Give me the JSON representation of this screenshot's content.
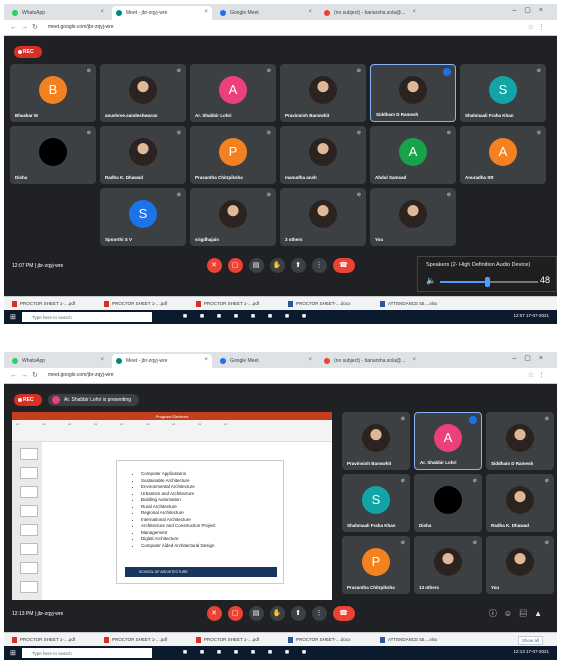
{
  "shot1": {
    "tabs": [
      {
        "label": "WhatsApp",
        "color": "#25d366",
        "active": false
      },
      {
        "label": "Meet - jbr-zqyj-wre",
        "color": "#00897b",
        "active": true
      },
      {
        "label": "Google Meet",
        "color": "#1a73e8",
        "active": false
      },
      {
        "label": "(no subject) - banarsha.sola@...",
        "color": "#ea4335",
        "active": false
      }
    ],
    "url": "meet.google.com/jbr-zqyj-wre",
    "rec_label": "REC",
    "tiles": [
      {
        "name": "Bhaskar M",
        "initial": "B",
        "color": "#f4811f",
        "kind": "letter"
      },
      {
        "name": "anushree.sandeshwaran",
        "initial": "",
        "color": "",
        "kind": "photo"
      },
      {
        "name": "Ar. Shabbir Lohri",
        "initial": "A",
        "color": "#ec407a",
        "kind": "letter"
      },
      {
        "name": "Pravinsinh Banswhit",
        "initial": "",
        "color": "",
        "kind": "photo"
      },
      {
        "name": "Siddham D Ramesh",
        "initial": "",
        "color": "",
        "kind": "photo"
      },
      {
        "name": "Shahmaali Fraha Khan",
        "initial": "S",
        "color": "#12a4a6",
        "kind": "letter"
      },
      {
        "name": "Disha",
        "initial": "",
        "color": "",
        "kind": "dark"
      },
      {
        "name": "Radha K. Dhawad",
        "initial": "",
        "color": "",
        "kind": "photo"
      },
      {
        "name": "Prasantha Chitrpiksha",
        "initial": "P",
        "color": "#f4811f",
        "kind": "letter"
      },
      {
        "name": "manudha ansh",
        "initial": "",
        "color": "",
        "kind": "photo"
      },
      {
        "name": "Abdul Samsad",
        "initial": "A",
        "color": "#16a34a",
        "kind": "letter"
      },
      {
        "name": "Anuradha SR",
        "initial": "A",
        "color": "#f4811f",
        "kind": "letter"
      },
      {
        "name": "Spoorthi S V",
        "initial": "S",
        "color": "#1a73e8",
        "kind": "letter"
      },
      {
        "name": "srigdhajain",
        "initial": "",
        "color": "",
        "kind": "photo"
      },
      {
        "name": "3 others",
        "initial": "",
        "color": "",
        "kind": "photo"
      },
      {
        "name": "You",
        "initial": "",
        "color": "",
        "kind": "photo"
      }
    ],
    "clock": "12:07 PM  |  jbr-zqyj-wre",
    "volume": {
      "device_label": "Speakers (2- High Definition Audio Device)",
      "value": "48",
      "fraction": 0.48
    },
    "downloads": [
      {
        "label": "PROCTOR SHEET 1-....pdf",
        "kind": "pdf"
      },
      {
        "label": "PROCTOR SHEET 1-....pdf",
        "kind": "pdf"
      },
      {
        "label": "PROCTOR SHEET 1-....pdf",
        "kind": "pdf"
      },
      {
        "label": "PROCTOR SHEET-....docx",
        "kind": "word"
      },
      {
        "label": "ATTENDANCE 55....xlsx",
        "kind": "word"
      }
    ],
    "search_placeholder": "Type here to search",
    "tray_time": "12:07 17-07-2021"
  },
  "shot2": {
    "tabs": [
      {
        "label": "WhatsApp",
        "color": "#25d366",
        "active": false
      },
      {
        "label": "Meet - jbr-zqyj-wre",
        "color": "#00897b",
        "active": true
      },
      {
        "label": "Google Meet",
        "color": "#1a73e8",
        "active": false
      },
      {
        "label": "(no subject) - banarsha.sola@...",
        "color": "#ea4335",
        "active": false
      }
    ],
    "url": "meet.google.com/jbr-zqyj-wre",
    "rec_label": "REC",
    "presenting": "Ar. Shabbir Lohri is presenting",
    "slide_title": "Program-Electives",
    "slide_items": [
      "Computer Applications",
      "Sustainable Architecture",
      "Environmental Architecture",
      "Urbanism and Architecture",
      "Building Automation",
      "Rural Architecture",
      "Regional Architecture",
      "International Architecture",
      "Architecture and Construction Project",
      "Management",
      "Digital Architecture",
      "Computer Aided Architectural Design"
    ],
    "slide_footer": "SCHOOL OF ARCHITECTURE",
    "tiles": [
      {
        "name": "Pravinsinh Banswhit",
        "initial": "",
        "color": "",
        "kind": "photo"
      },
      {
        "name": "Ar. Shabbir Lohri",
        "initial": "A",
        "color": "#ec407a",
        "kind": "letter"
      },
      {
        "name": "Siddham D Ramesh",
        "initial": "",
        "color": "",
        "kind": "photo"
      },
      {
        "name": "Shahmaali Fraha Khan",
        "initial": "S",
        "color": "#12a4a6",
        "kind": "letter"
      },
      {
        "name": "Disha",
        "initial": "",
        "color": "",
        "kind": "dark"
      },
      {
        "name": "Radha K. Dhawad",
        "initial": "",
        "color": "",
        "kind": "photo"
      },
      {
        "name": "Prasantha Chitrpiksha",
        "initial": "P",
        "color": "#f4811f",
        "kind": "letter"
      },
      {
        "name": "13 others",
        "initial": "",
        "color": "",
        "kind": "photo"
      },
      {
        "name": "You",
        "initial": "",
        "color": "",
        "kind": "photo"
      }
    ],
    "clock": "12:13 PM  |  jbr-zqyj-wre",
    "downloads": [
      {
        "label": "PROCTOR SHEET 1-....pdf",
        "kind": "pdf"
      },
      {
        "label": "PROCTOR SHEET 1-....pdf",
        "kind": "pdf"
      },
      {
        "label": "PROCTOR SHEET 1-....pdf",
        "kind": "pdf"
      },
      {
        "label": "PROCTOR SHEET-....docx",
        "kind": "word"
      },
      {
        "label": "ATTENDANCE 55....xlsx",
        "kind": "word"
      }
    ],
    "show_all": "Show all",
    "search_placeholder": "Type here to search",
    "tray_time": "12:13 17-07-2021"
  },
  "controls": {
    "mic": "mic-off-icon",
    "cam": "camera-off-icon",
    "cc": "captions-icon",
    "hand": "raise-hand-icon",
    "present": "present-icon",
    "more": "more-icon",
    "end": "end-call-icon"
  }
}
